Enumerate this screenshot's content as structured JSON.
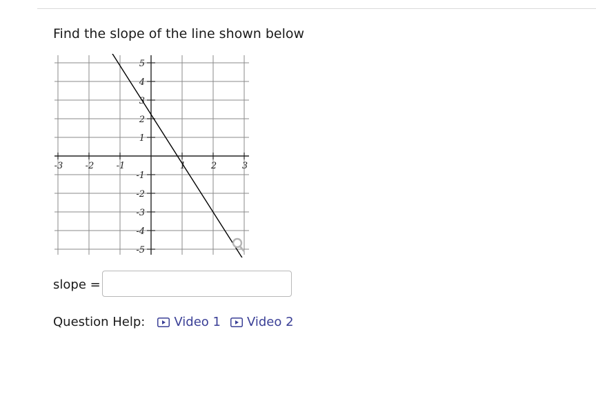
{
  "question": {
    "title": "Find the slope of the line shown below"
  },
  "graph": {
    "x_range": [
      -3,
      3
    ],
    "y_range": [
      -5,
      5
    ],
    "x_ticks": [
      "-3",
      "-2",
      "-1",
      "1",
      "2",
      "3"
    ],
    "y_ticks": [
      "5",
      "4",
      "3",
      "2",
      "1",
      "-1",
      "-2",
      "-3",
      "-4",
      "-5"
    ],
    "line": {
      "points": [
        [
          -1.25,
          5.5
        ],
        [
          2.95,
          -5.5
        ]
      ],
      "color": "#000000"
    },
    "grid_color": "#8a8a8a",
    "magnifier_icon": "magnifier-icon"
  },
  "answer": {
    "label": "slope =",
    "value": "",
    "placeholder": ""
  },
  "help": {
    "label": "Question Help:",
    "links": [
      {
        "label": "Video 1",
        "icon": "play-video-icon"
      },
      {
        "label": "Video 2",
        "icon": "play-video-icon"
      }
    ],
    "link_color": "#3a3f96"
  }
}
